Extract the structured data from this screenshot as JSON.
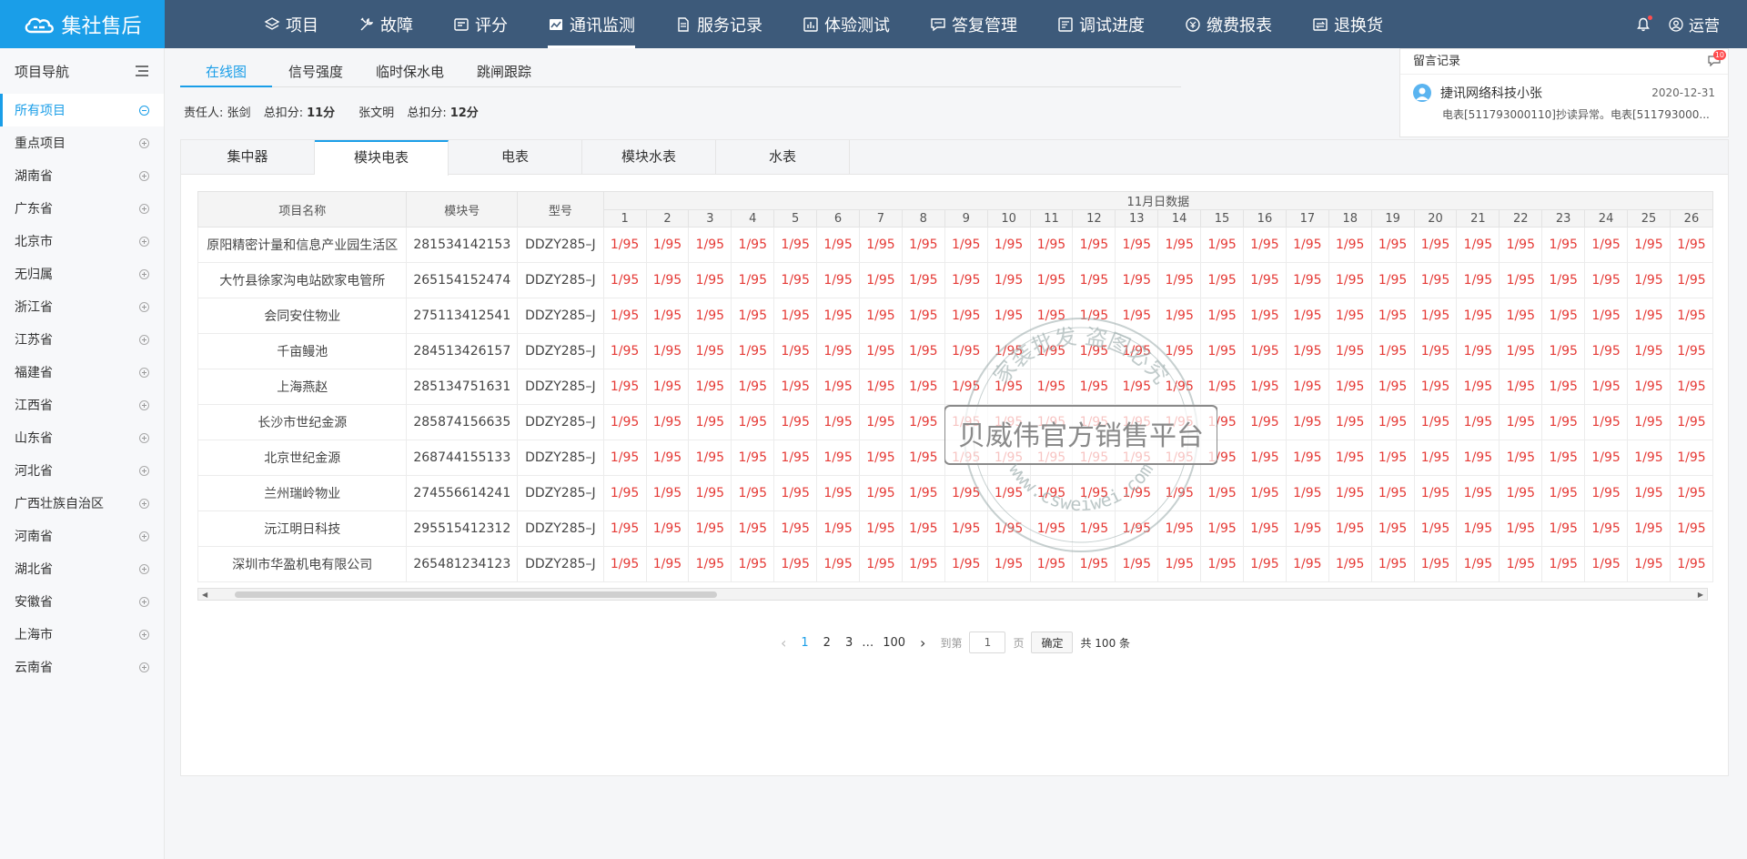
{
  "header": {
    "logo_text": "集社售后",
    "nav": [
      {
        "label": "项目",
        "icon": "layers-icon"
      },
      {
        "label": "故障",
        "icon": "tools-icon"
      },
      {
        "label": "评分",
        "icon": "score-icon"
      },
      {
        "label": "通讯监测",
        "icon": "monitor-icon",
        "active": true
      },
      {
        "label": "服务记录",
        "icon": "document-icon"
      },
      {
        "label": "体验测试",
        "icon": "chart-icon"
      },
      {
        "label": "答复管理",
        "icon": "reply-icon"
      },
      {
        "label": "调试进度",
        "icon": "progress-icon"
      },
      {
        "label": "缴费报表",
        "icon": "payment-icon"
      },
      {
        "label": "退换货",
        "icon": "return-icon"
      }
    ],
    "user_label": "运营"
  },
  "sidebar": {
    "title": "项目导航",
    "items": [
      {
        "label": "所有项目",
        "active": true
      },
      {
        "label": "重点项目"
      },
      {
        "label": "湖南省"
      },
      {
        "label": "广东省"
      },
      {
        "label": "北京市"
      },
      {
        "label": "无归属"
      },
      {
        "label": "浙江省"
      },
      {
        "label": "江苏省"
      },
      {
        "label": "福建省"
      },
      {
        "label": "江西省"
      },
      {
        "label": "山东省"
      },
      {
        "label": "河北省"
      },
      {
        "label": "广西壮族自治区"
      },
      {
        "label": "河南省"
      },
      {
        "label": "湖北省"
      },
      {
        "label": "安徽省"
      },
      {
        "label": "上海市"
      },
      {
        "label": "云南省"
      }
    ]
  },
  "top_tabs": [
    "在线图",
    "信号强度",
    "临时保水电",
    "跳闸跟踪"
  ],
  "responsible": {
    "label1": "责任人:",
    "name1": "张剑",
    "deduct_label": "总扣分:",
    "score1": "11分",
    "name2": "张文明",
    "score2": "12分"
  },
  "message": {
    "title": "留言记录",
    "badge": "10",
    "sender": "捷讯网络科技小张",
    "date": "2020-12-31",
    "body": "电表[511793000110]抄读异常。电表[511793000..."
  },
  "sub_tabs": [
    "集中器",
    "模块电表",
    "电表",
    "模块水表",
    "水表"
  ],
  "table": {
    "headers": {
      "project": "项目名称",
      "module": "模块号",
      "model": "型号",
      "group": "11月日数据"
    },
    "days": [
      "1",
      "2",
      "3",
      "4",
      "5",
      "6",
      "7",
      "8",
      "9",
      "10",
      "11",
      "12",
      "13",
      "14",
      "15",
      "16",
      "17",
      "18",
      "19",
      "20",
      "21",
      "22",
      "23",
      "24",
      "25",
      "26"
    ],
    "cell_value": "1/95",
    "rows": [
      {
        "project": "原阳精密计量和信息产业园生活区",
        "module": "281534142153",
        "model": "DDZY285–J"
      },
      {
        "project": "大竹县徐家沟电站欧家电管所",
        "module": "265154152474",
        "model": "DDZY285–J"
      },
      {
        "project": "会同安住物业",
        "module": "275113412541",
        "model": "DDZY285–J"
      },
      {
        "project": "千亩鳗池",
        "module": "284513426157",
        "model": "DDZY285–J"
      },
      {
        "project": "上海燕赵",
        "module": "285134751631",
        "model": "DDZY285–J"
      },
      {
        "project": "长沙市世纪金源",
        "module": "285874156635",
        "model": "DDZY285–J"
      },
      {
        "project": "北京世纪金源",
        "module": "268744155133",
        "model": "DDZY285–J"
      },
      {
        "project": "兰州瑞岭物业",
        "module": "274556614241",
        "model": "DDZY285–J"
      },
      {
        "project": "沅江明日科技",
        "module": "295515412312",
        "model": "DDZY285–J"
      },
      {
        "project": "深圳市华盈机电有限公司",
        "module": "265481234123",
        "model": "DDZY285–J"
      }
    ]
  },
  "pager": {
    "pages": [
      "1",
      "2",
      "3",
      "…",
      "100"
    ],
    "goto_label": "到第",
    "goto_value": "1",
    "page_unit": "页",
    "confirm": "确定",
    "total": "共 100 条"
  },
  "watermark": {
    "ring_text": "家装批发 盗图必究",
    "brand": "贝威伟官方销售平台",
    "url": "www.csweiwei.com"
  },
  "colors": {
    "accent": "#1a9ee8",
    "header_bg": "#3d5a7a",
    "value_red": "#e53935"
  }
}
